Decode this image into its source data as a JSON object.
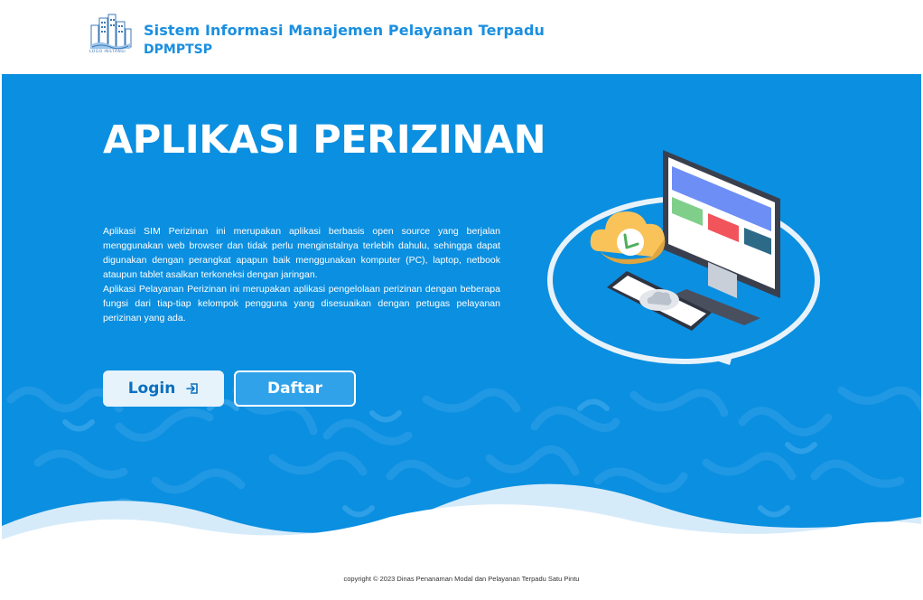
{
  "header": {
    "title": "Sistem Informasi Manajemen Pelayanan Terpadu",
    "subtitle": "DPMPTSP",
    "logo_caption": "LOGO INSTANSI",
    "logo_icon": "city-buildings-logo"
  },
  "hero": {
    "title": "APLIKASI PERIZINAN",
    "description_1": "Aplikasi SIM Perizinan ini merupakan aplikasi berbasis open source yang berjalan menggunakan web browser dan tidak perlu menginstalnya terlebih dahulu, sehingga dapat digunakan dengan perangkat apapun baik menggunakan komputer (PC), laptop, netbook ataupun tablet asalkan terkoneksi dengan jaringan.",
    "description_2": "Aplikasi Pelayanan Perizinan ini merupakan aplikasi pengelolaan perizinan dengan beberapa fungsi dari tiap-tiap kelompok pengguna yang disesuaikan dengan petugas pelayanan perizinan yang ada.",
    "login_label": "Login",
    "login_icon": "sign-in-icon",
    "register_label": "Daftar",
    "illustration": "cloud-sync-devices-illustration"
  },
  "footer": {
    "copyright": "copyright © 2023 Dinas Penanaman Modal dan Pelayanan Terpadu Satu Pintu"
  },
  "colors": {
    "brand": "#1a8fe0",
    "hero_bg": "#0b8fe0",
    "button_light": "#e6f3fb"
  }
}
